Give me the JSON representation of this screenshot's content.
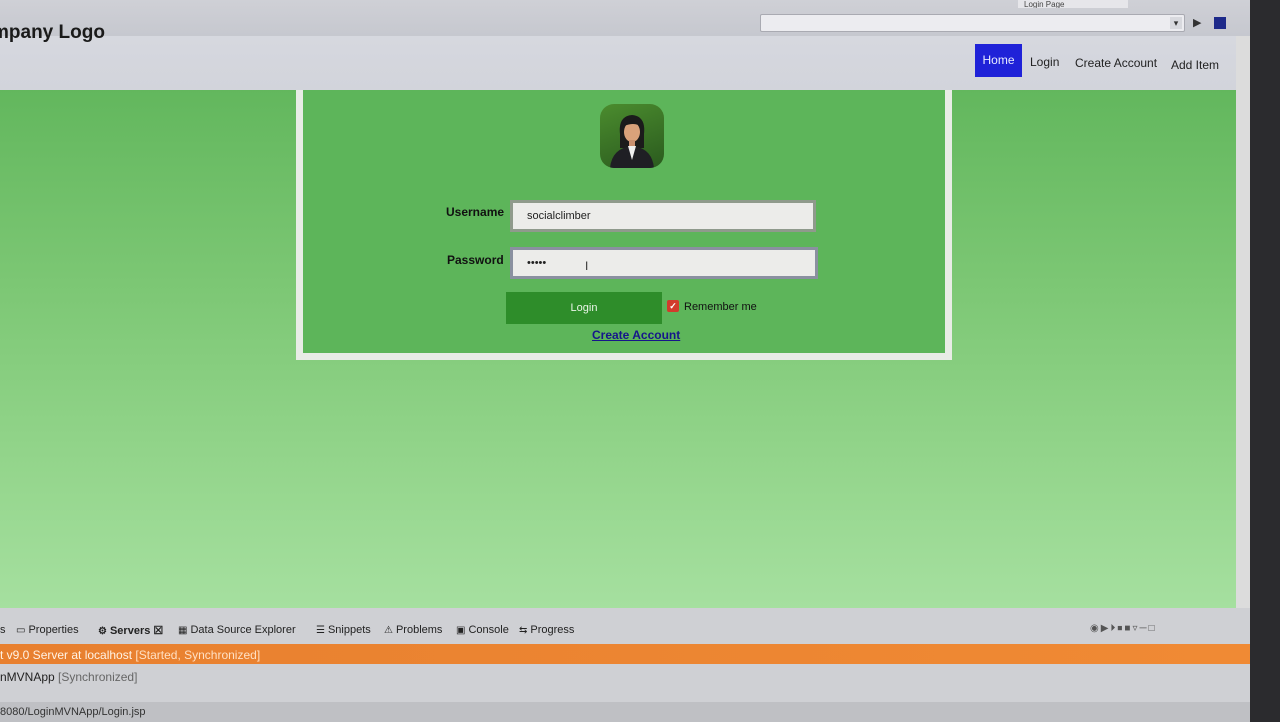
{
  "browser": {
    "tab_label": "Login Page",
    "run_symbol": "▶",
    "dropdown_symbol": "▾"
  },
  "navbar": {
    "brand": "mpany Logo",
    "items": [
      {
        "label": "Home",
        "active": true
      },
      {
        "label": "Login"
      },
      {
        "label": "Create Account"
      },
      {
        "label": "Add Item"
      }
    ],
    "active_color": "#1f22d8"
  },
  "login_form": {
    "username_label": "Username",
    "username_value": "socialclimber",
    "password_label": "Password",
    "password_value": "•••••",
    "login_button": "Login",
    "remember_me_label": "Remember me",
    "remember_me_checked": true,
    "create_account_link": "Create Account",
    "accent_color": "#2e8d2a"
  },
  "ide_panel": {
    "tabs": [
      {
        "label": "Properties",
        "icon": "properties-icon"
      },
      {
        "label": "Servers",
        "icon": "servers-icon",
        "active": true
      },
      {
        "label": "Data Source Explorer",
        "icon": "database-icon"
      },
      {
        "label": "Snippets",
        "icon": "snippets-icon"
      },
      {
        "label": "Problems",
        "icon": "problems-icon"
      },
      {
        "label": "Console",
        "icon": "console-icon"
      },
      {
        "label": "Progress",
        "icon": "progress-icon"
      }
    ],
    "tab_prefix": "s",
    "server_name": "t v9.0 Server at localhost",
    "server_status": "[Started, Synchronized]",
    "app_name": "nMVNApp",
    "app_status": "[Synchronized]"
  },
  "status_bar": {
    "url": "8080/LoginMVNApp/Login.jsp"
  }
}
